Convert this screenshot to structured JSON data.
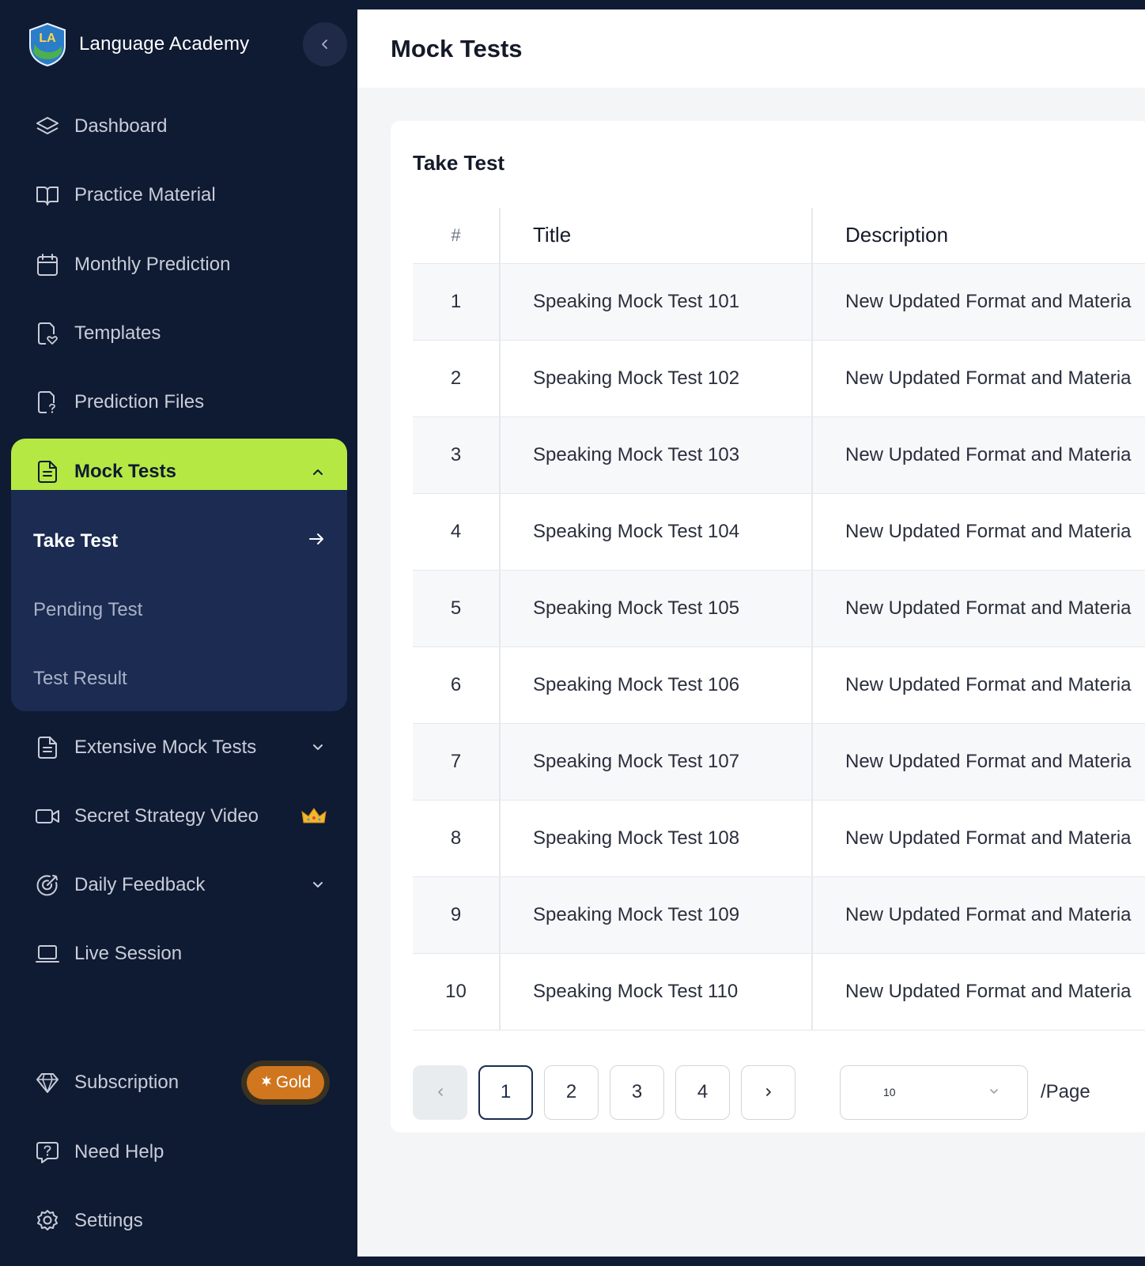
{
  "app": {
    "name": "Language Academy",
    "logo_text": "LA"
  },
  "sidebar": {
    "items": [
      {
        "label": "Dashboard",
        "icon": "layers-icon"
      },
      {
        "label": "Practice Material",
        "icon": "book-open-icon"
      },
      {
        "label": "Monthly Prediction",
        "icon": "calendar-icon"
      },
      {
        "label": "Templates",
        "icon": "file-heart-icon"
      },
      {
        "label": "Prediction Files",
        "icon": "file-question-icon"
      },
      {
        "label": "Mock Tests",
        "icon": "file-text-icon",
        "expanded": true
      },
      {
        "label": "Extensive Mock Tests",
        "icon": "file-text-icon"
      },
      {
        "label": "Secret Strategy Video",
        "icon": "video-icon",
        "premium": "crown-icon"
      },
      {
        "label": "Daily Feedback",
        "icon": "target-icon"
      },
      {
        "label": "Live Session",
        "icon": "laptop-icon"
      }
    ],
    "submenu": [
      {
        "label": "Take Test",
        "current": true
      },
      {
        "label": "Pending Test"
      },
      {
        "label": "Test Result"
      }
    ],
    "bottom": [
      {
        "label": "Subscription",
        "icon": "diamond-icon",
        "badge": "Gold"
      },
      {
        "label": "Need Help",
        "icon": "help-chat-icon"
      },
      {
        "label": "Settings",
        "icon": "gear-icon"
      }
    ]
  },
  "header": {
    "title": "Mock Tests"
  },
  "card": {
    "title": "Take Test",
    "columns": [
      "#",
      "Title",
      "Description"
    ],
    "rows": [
      {
        "num": "1",
        "title": "Speaking Mock Test 101",
        "description": "New Updated Format and Materia"
      },
      {
        "num": "2",
        "title": "Speaking Mock Test 102",
        "description": "New Updated Format and Materia"
      },
      {
        "num": "3",
        "title": "Speaking Mock Test 103",
        "description": "New Updated Format and Materia"
      },
      {
        "num": "4",
        "title": "Speaking Mock Test 104",
        "description": "New Updated Format and Materia"
      },
      {
        "num": "5",
        "title": "Speaking Mock Test 105",
        "description": "New Updated Format and Materia"
      },
      {
        "num": "6",
        "title": "Speaking Mock Test 106",
        "description": "New Updated Format and Materia"
      },
      {
        "num": "7",
        "title": "Speaking Mock Test 107",
        "description": "New Updated Format and Materia"
      },
      {
        "num": "8",
        "title": "Speaking Mock Test 108",
        "description": "New Updated Format and Materia"
      },
      {
        "num": "9",
        "title": "Speaking Mock Test 109",
        "description": "New Updated Format and Materia"
      },
      {
        "num": "10",
        "title": "Speaking Mock Test 110",
        "description": "New Updated Format and Materia"
      }
    ]
  },
  "pagination": {
    "pages": [
      "1",
      "2",
      "3",
      "4"
    ],
    "current": "1",
    "per_page": "10",
    "per_page_label": "/Page"
  },
  "colors": {
    "accent": "#b5e843",
    "sidebar_bg": "#0f1a33",
    "submenu_bg": "#1b2b52",
    "gold": "#d0761f"
  }
}
